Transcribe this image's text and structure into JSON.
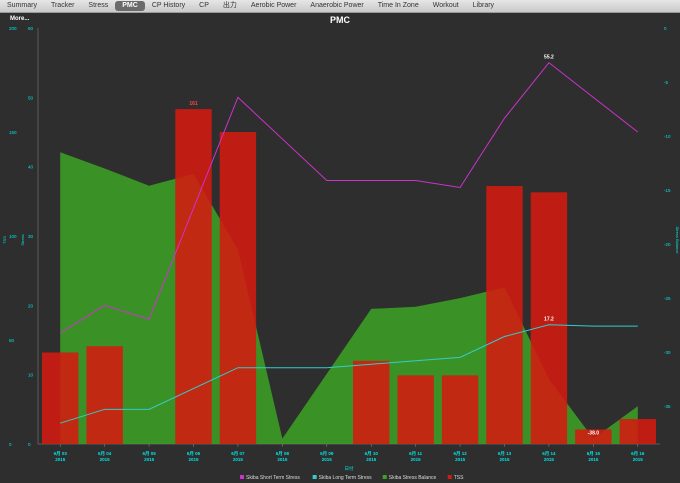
{
  "tabs": [
    {
      "label": "Summary"
    },
    {
      "label": "Tracker"
    },
    {
      "label": "Stress"
    },
    {
      "label": "PMC",
      "active": true
    },
    {
      "label": "CP History"
    },
    {
      "label": "CP"
    },
    {
      "label": "出力"
    },
    {
      "label": "Aerobic Power"
    },
    {
      "label": "Anaerobic Power"
    },
    {
      "label": "Time In Zone"
    },
    {
      "label": "Workout"
    },
    {
      "label": "Library"
    }
  ],
  "more_label": "More...",
  "chart_data": {
    "type": "bar",
    "title": "PMC",
    "xlabel": "日付",
    "categories": [
      "6月 03\n2015",
      "6月 04\n2015",
      "6月 05\n2015",
      "6月 06\n2015",
      "6月 07\n2015",
      "6月 08\n2015",
      "6月 09\n2015",
      "6月 10\n2015",
      "6月 11\n2015",
      "6月 12\n2015",
      "6月 13\n2015",
      "6月 14\n2015",
      "6月 15\n2015",
      "6月 16\n2015"
    ],
    "axes": {
      "tss": {
        "label": "TSS",
        "ticks": [
          0,
          50,
          100,
          150,
          200
        ],
        "range": [
          0,
          200
        ],
        "color": "#00e6e6"
      },
      "stress": {
        "label": "Stress",
        "ticks": [
          0,
          10,
          20,
          30,
          40,
          50,
          60
        ],
        "range": [
          0,
          60
        ],
        "color": "#00e6e6"
      },
      "balance": {
        "label": "Stress Balance",
        "ticks": [
          0,
          -5,
          -10,
          -15,
          -20,
          -25,
          -30,
          -35
        ],
        "range": [
          -38.5,
          0
        ],
        "color": "#00e6e6"
      }
    },
    "series": [
      {
        "name": "Skiba Short Term Stress",
        "axis": "stress",
        "color": "#cc33cc",
        "values": [
          16,
          20,
          18,
          null,
          50,
          44,
          38,
          38,
          38,
          37,
          47,
          55,
          50,
          45
        ]
      },
      {
        "name": "Skiba Long Term Stress",
        "axis": "stress",
        "color": "#33cccc",
        "values": [
          3,
          5,
          5,
          null,
          11,
          11,
          11,
          11.5,
          12,
          12.5,
          15.5,
          17.2,
          17,
          17
        ]
      },
      {
        "name": "Skiba Stress Balance",
        "axis": "balance",
        "color": "#3ca324",
        "values": [
          -11.5,
          -13,
          -14.6,
          -13.5,
          -20.5,
          -38,
          null,
          -26,
          -25.8,
          -25,
          -24,
          -32.5,
          -38,
          -35
        ]
      },
      {
        "name": "TSS",
        "axis": "tss",
        "color": "#d41a10",
        "values": [
          44,
          47,
          null,
          161,
          150,
          null,
          null,
          40,
          33,
          33,
          124,
          121,
          7,
          12
        ]
      }
    ],
    "annotations": [
      {
        "text": "161",
        "series": "TSS",
        "index": 3
      },
      {
        "text": "55.2",
        "series": "Skiba Short Term Stress",
        "index": 11
      },
      {
        "text": "17.2",
        "series": "Skiba Long Term Stress",
        "index": 11
      },
      {
        "text": "-38.0",
        "series": "Skiba Stress Balance",
        "index": 12
      }
    ],
    "legend_position": "bottom",
    "grid": false
  }
}
